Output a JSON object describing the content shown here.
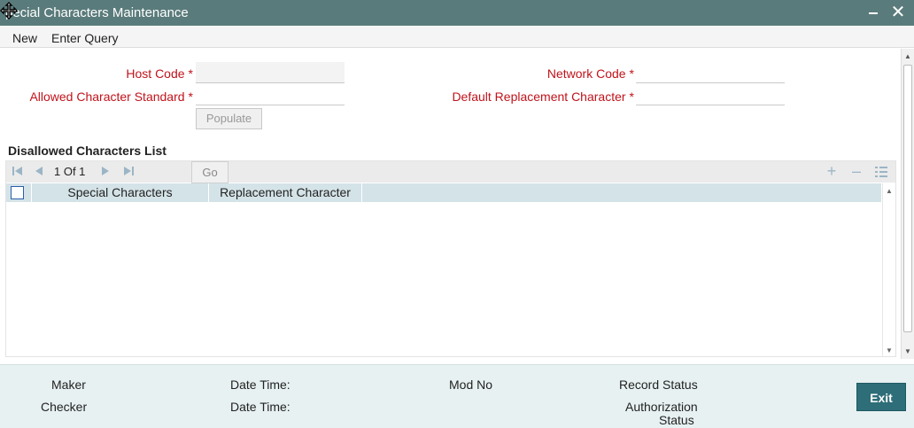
{
  "window": {
    "title": "Special Characters Maintenance",
    "title_visible": "pecial Characters Maintenance"
  },
  "menu": {
    "new_label": "New",
    "enter_query_label": "Enter Query"
  },
  "form": {
    "host_code_label": "Host Code",
    "network_code_label": "Network Code",
    "allowed_char_std_label": "Allowed Character Standard",
    "default_replacement_label": "Default Replacement Character",
    "required_marker": "*",
    "host_code_value": "",
    "network_code_value": "",
    "allowed_char_std_value": "",
    "default_replacement_value": "",
    "populate_label": "Populate"
  },
  "grid": {
    "section_title": "Disallowed Characters List",
    "page_text": "1 Of 1",
    "go_label": "Go",
    "columns": [
      "Special Characters",
      "Replacement Character"
    ],
    "rows": []
  },
  "footer": {
    "maker_label": "Maker",
    "checker_label": "Checker",
    "date_time_label": "Date Time:",
    "mod_no_label": "Mod No",
    "record_status_label": "Record Status",
    "authorization_status_label_1": "Authorization",
    "authorization_status_label_2": "Status",
    "exit_label": "Exit"
  },
  "colors": {
    "title_bar": "#5a7b7b",
    "required_label": "#c0131b",
    "grid_header": "#d4e3e8",
    "footer_bg": "#e7f1f2",
    "exit_button": "#2d6e78"
  },
  "icons": [
    "move-icon",
    "minimize-icon",
    "close-icon",
    "first-page-icon",
    "prev-page-icon",
    "next-page-icon",
    "last-page-icon",
    "add-row-icon",
    "delete-row-icon",
    "single-view-icon"
  ]
}
